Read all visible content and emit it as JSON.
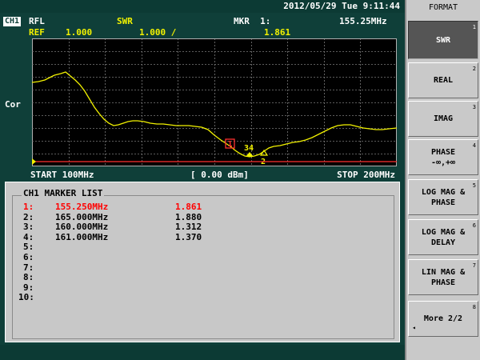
{
  "topbar": {
    "datetime": "2012/05/29  Tue   9:11:44"
  },
  "header": {
    "channel": "CH1",
    "meas": "RFL",
    "format": "SWR",
    "marker_label": "MKR  1:",
    "marker_freq": "155.25MHz",
    "ref_label": "REF",
    "ref_value": "1.000",
    "scale_value": "1.000 /",
    "marker_value": "1.861"
  },
  "side_label": "Cor",
  "footer": {
    "start": "START 100MHz",
    "power": "[ 0.00 dBm]",
    "stop": "STOP 200MHz"
  },
  "marker_list": {
    "title": "CH1 MARKER LIST",
    "rows": [
      {
        "n": "1:",
        "freq": "155.250MHz",
        "value": "1.861"
      },
      {
        "n": "2:",
        "freq": "165.000MHz",
        "value": "1.880"
      },
      {
        "n": "3:",
        "freq": "160.000MHz",
        "value": "1.312"
      },
      {
        "n": "4:",
        "freq": "161.000MHz",
        "value": "1.370"
      },
      {
        "n": "5:",
        "freq": "",
        "value": ""
      },
      {
        "n": "6:",
        "freq": "",
        "value": ""
      },
      {
        "n": "7:",
        "freq": "",
        "value": ""
      },
      {
        "n": "8:",
        "freq": "",
        "value": ""
      },
      {
        "n": "9:",
        "freq": "",
        "value": ""
      },
      {
        "n": "10:",
        "freq": "",
        "value": ""
      }
    ]
  },
  "trace_markers": {
    "m1": "1",
    "m34": "34",
    "m2": "2"
  },
  "menu": {
    "title": "FORMAT",
    "keys": [
      {
        "line1": "SWR",
        "line2": "",
        "num": "1"
      },
      {
        "line1": "REAL",
        "line2": "",
        "num": "2"
      },
      {
        "line1": "IMAG",
        "line2": "",
        "num": "3"
      },
      {
        "line1": "PHASE",
        "line2": "-∞,+∞",
        "num": "4"
      },
      {
        "line1": "LOG MAG &",
        "line2": "PHASE",
        "num": "5"
      },
      {
        "line1": "LOG MAG &",
        "line2": "DELAY",
        "num": "6"
      },
      {
        "line1": "LIN MAG &",
        "line2": "PHASE",
        "num": "7"
      },
      {
        "line1": "More 2/2",
        "line2": "",
        "num": "8"
      }
    ]
  },
  "colors": {
    "trace": "#f2f200",
    "active_marker": "#ff0000",
    "grid": "#8a8a8a"
  }
}
